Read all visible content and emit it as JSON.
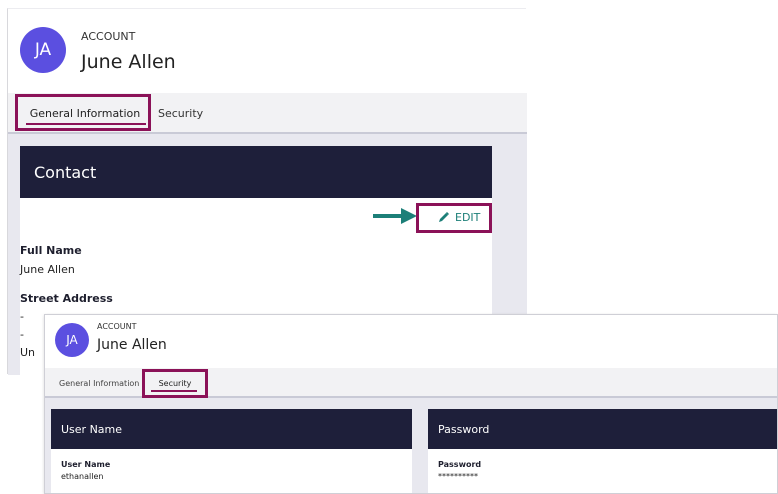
{
  "top": {
    "avatar_initials": "JA",
    "overline": "ACCOUNT",
    "name": "June Allen",
    "tabs": [
      {
        "label": "General Information"
      },
      {
        "label": "Security"
      }
    ],
    "contact": {
      "header": "Contact",
      "edit_label": "EDIT",
      "full_name_label": "Full Name",
      "full_name_value": "June Allen",
      "street_label": "Street Address",
      "street_lines": [
        "-",
        "-",
        "Un"
      ]
    }
  },
  "bottom": {
    "avatar_initials": "JA",
    "overline": "ACCOUNT",
    "name": "June Allen",
    "tabs": [
      {
        "label": "General Information"
      },
      {
        "label": "Security"
      }
    ],
    "username_card": {
      "header": "User Name",
      "label": "User Name",
      "value": "ethanallen"
    },
    "password_card": {
      "header": "Password",
      "label": "Password",
      "value": "**********"
    }
  },
  "colors": {
    "accent": "#8b1258",
    "header_bg": "#1e1f3a",
    "teal": "#1c7f78",
    "avatar": "#5b4fe0"
  }
}
